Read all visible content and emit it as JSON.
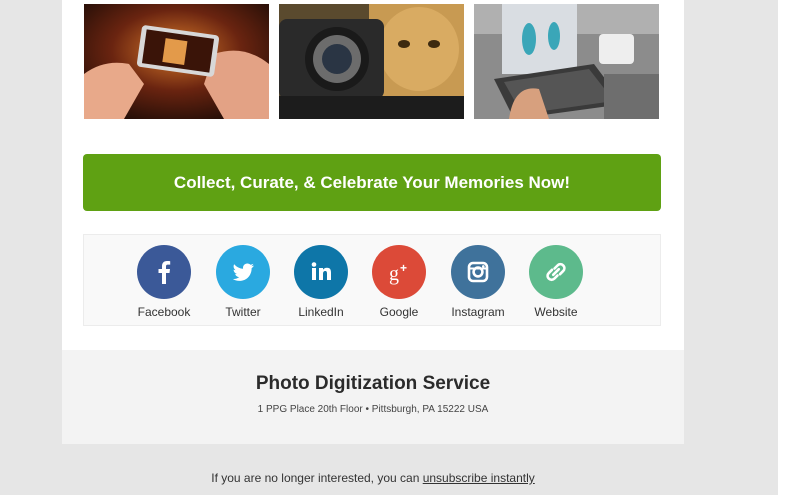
{
  "cta": {
    "label": "Collect, Curate, & Celebrate Your Memories Now!"
  },
  "social": [
    {
      "label": "Facebook",
      "icon": "facebook-icon",
      "color": "#3b5998"
    },
    {
      "label": "Twitter",
      "icon": "twitter-icon",
      "color": "#2aa9e0"
    },
    {
      "label": "LinkedIn",
      "icon": "linkedin-icon",
      "color": "#0e76a8"
    },
    {
      "label": "Google",
      "icon": "google-plus-icon",
      "color": "#dc4a38"
    },
    {
      "label": "Instagram",
      "icon": "instagram-icon",
      "color": "#3f729b"
    },
    {
      "label": "Website",
      "icon": "link-icon",
      "color": "#5dba8c"
    }
  ],
  "footer": {
    "title": "Photo Digitization Service",
    "address": "1 PPG Place 20th Floor • Pittsburgh, PA 15222 USA"
  },
  "unsubscribe": {
    "text": "If you are no longer interested, you can ",
    "link": "unsubscribe instantly"
  },
  "colors": {
    "cta": "#5fa113",
    "page_background": "#e6e6e6",
    "footer_background": "#f3f3f3"
  }
}
